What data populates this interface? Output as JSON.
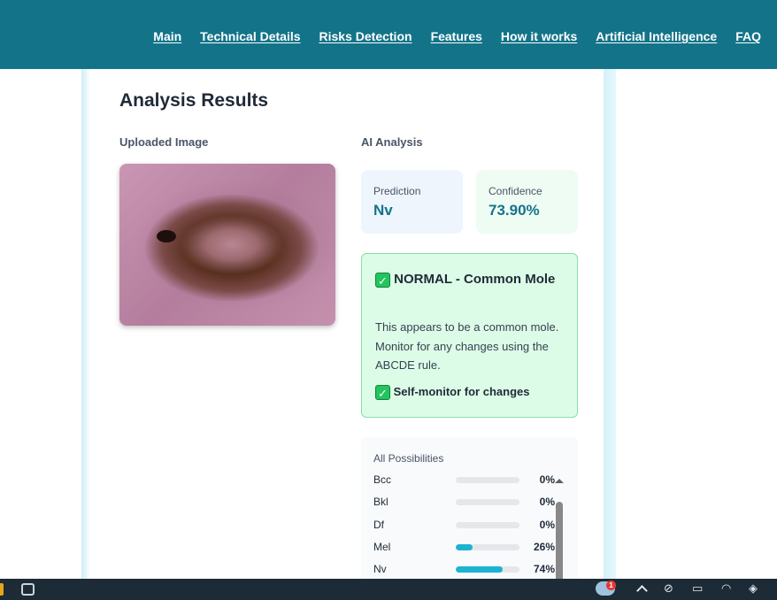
{
  "nav": {
    "items": [
      "Main",
      "Technical Details",
      "Risks Detection",
      "Features",
      "How it works",
      "Artificial Intelligence",
      "FAQ"
    ]
  },
  "results": {
    "title": "Analysis Results",
    "uploaded_label": "Uploaded Image",
    "ai_label": "AI Analysis",
    "prediction_label": "Prediction",
    "prediction_value": "Nv",
    "confidence_label": "Confidence",
    "confidence_value": "73.90%"
  },
  "verdict": {
    "check_glyph": "✓",
    "title": "NORMAL - Common Mole",
    "text": "This appears to be a common mole. Monitor for any changes using the ABCDE rule.",
    "footer": "Self-monitor for changes"
  },
  "possibilities": {
    "title": "All Possibilities",
    "items": [
      {
        "name": "Bcc",
        "value": 0,
        "label": "0%"
      },
      {
        "name": "Bkl",
        "value": 0,
        "label": "0%"
      },
      {
        "name": "Df",
        "value": 0,
        "label": "0%"
      },
      {
        "name": "Mel",
        "value": 26,
        "label": "26%"
      },
      {
        "name": "Nv",
        "value": 74,
        "label": "74%"
      }
    ]
  },
  "taskbar": {
    "notification_count": "1",
    "icons": [
      "app-icon",
      "weather-icon",
      "chevron-up-icon",
      "eye-off-icon",
      "battery-icon",
      "wifi-icon",
      "shield-icon"
    ]
  },
  "colors": {
    "header": "#137489",
    "accent": "#1bb3d1",
    "verdict_bg": "#dcfce7",
    "verdict_border": "#86e0a6"
  }
}
